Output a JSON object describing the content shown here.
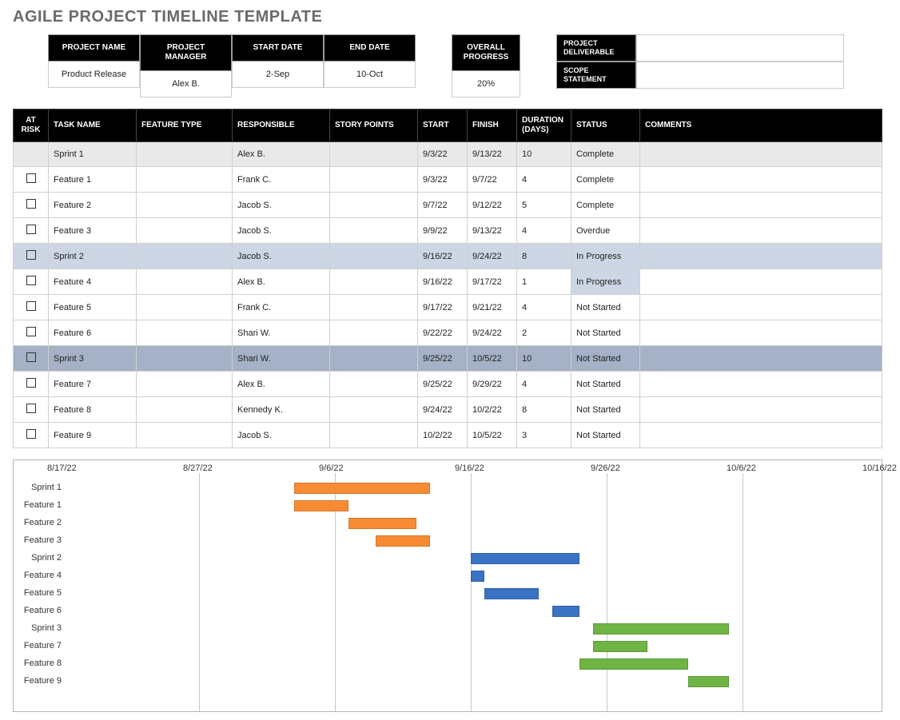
{
  "title": "AGILE PROJECT TIMELINE TEMPLATE",
  "project_headers": {
    "name": "PROJECT NAME",
    "manager": "PROJECT MANAGER",
    "start": "START DATE",
    "end": "END DATE"
  },
  "project_values": {
    "name": "Product Release",
    "manager": "Alex B.",
    "start": "2-Sep",
    "end": "10-Oct"
  },
  "overall": {
    "label": "OVERALL PROGRESS",
    "value": "20%"
  },
  "side": {
    "deliverable": "PROJECT DELIVERABLE",
    "scope": "SCOPE STATEMENT"
  },
  "task_headers": {
    "risk": "AT RISK",
    "task": "TASK NAME",
    "feature": "FEATURE TYPE",
    "resp": "RESPONSIBLE",
    "story": "STORY POINTS",
    "start": "START",
    "finish": "FINISH",
    "duration": "DURATION (DAYS)",
    "status": "STATUS",
    "comments": "COMMENTS"
  },
  "tasks": [
    {
      "row_class": "row-sprint1",
      "risk": false,
      "name": "Sprint 1",
      "feature": "",
      "resp": "Alex B.",
      "story": "",
      "start": "9/3/22",
      "finish": "9/13/22",
      "duration": "10",
      "status": "Complete",
      "comments": ""
    },
    {
      "row_class": "",
      "risk": true,
      "name": "Feature 1",
      "feature": "",
      "resp": "Frank C.",
      "story": "",
      "start": "9/3/22",
      "finish": "9/7/22",
      "duration": "4",
      "status": "Complete",
      "comments": ""
    },
    {
      "row_class": "",
      "risk": true,
      "name": "Feature 2",
      "feature": "",
      "resp": "Jacob S.",
      "story": "",
      "start": "9/7/22",
      "finish": "9/12/22",
      "duration": "5",
      "status": "Complete",
      "comments": ""
    },
    {
      "row_class": "",
      "risk": true,
      "name": "Feature 3",
      "feature": "",
      "resp": "Jacob S.",
      "story": "",
      "start": "9/9/22",
      "finish": "9/13/22",
      "duration": "4",
      "status": "Overdue",
      "comments": ""
    },
    {
      "row_class": "row-sprint2",
      "risk": true,
      "name": "Sprint 2",
      "feature": "",
      "resp": "Jacob S.",
      "story": "",
      "start": "9/16/22",
      "finish": "9/24/22",
      "duration": "8",
      "status": "In Progress",
      "comments": ""
    },
    {
      "row_class": "row-prog",
      "risk": true,
      "name": "Feature 4",
      "feature": "",
      "resp": "Alex B.",
      "story": "",
      "start": "9/16/22",
      "finish": "9/17/22",
      "duration": "1",
      "status": "In Progress",
      "comments": ""
    },
    {
      "row_class": "",
      "risk": true,
      "name": "Feature 5",
      "feature": "",
      "resp": "Frank C.",
      "story": "",
      "start": "9/17/22",
      "finish": "9/21/22",
      "duration": "4",
      "status": "Not Started",
      "comments": ""
    },
    {
      "row_class": "",
      "risk": true,
      "name": "Feature 6",
      "feature": "",
      "resp": "Shari W.",
      "story": "",
      "start": "9/22/22",
      "finish": "9/24/22",
      "duration": "2",
      "status": "Not Started",
      "comments": ""
    },
    {
      "row_class": "row-sprint3",
      "risk": true,
      "name": "Sprint 3",
      "feature": "",
      "resp": "Shari W.",
      "story": "",
      "start": "9/25/22",
      "finish": "10/5/22",
      "duration": "10",
      "status": "Not Started",
      "comments": ""
    },
    {
      "row_class": "",
      "risk": true,
      "name": "Feature 7",
      "feature": "",
      "resp": "Alex B.",
      "story": "",
      "start": "9/25/22",
      "finish": "9/29/22",
      "duration": "4",
      "status": "Not Started",
      "comments": ""
    },
    {
      "row_class": "",
      "risk": true,
      "name": "Feature 8",
      "feature": "",
      "resp": "Kennedy K.",
      "story": "",
      "start": "9/24/22",
      "finish": "10/2/22",
      "duration": "8",
      "status": "Not Started",
      "comments": ""
    },
    {
      "row_class": "",
      "risk": true,
      "name": "Feature 9",
      "feature": "",
      "resp": "Jacob S.",
      "story": "",
      "start": "10/2/22",
      "finish": "10/5/22",
      "duration": "3",
      "status": "Not Started",
      "comments": ""
    }
  ],
  "chart_data": {
    "type": "gantt",
    "x_ticks": [
      "8/17/22",
      "8/27/22",
      "9/6/22",
      "9/16/22",
      "9/26/22",
      "10/6/22",
      "10/16/22"
    ],
    "x_range_days": 60,
    "x_start": "8/17/22",
    "colors": {
      "sprint1": "#f78b33",
      "sprint2": "#3a72c4",
      "sprint3": "#6fb444"
    },
    "bars": [
      {
        "label": "Sprint 1",
        "start_day": 17,
        "dur": 10,
        "color": "c-orange"
      },
      {
        "label": "Feature 1",
        "start_day": 17,
        "dur": 4,
        "color": "c-orange"
      },
      {
        "label": "Feature 2",
        "start_day": 21,
        "dur": 5,
        "color": "c-orange"
      },
      {
        "label": "Feature 3",
        "start_day": 23,
        "dur": 4,
        "color": "c-orange"
      },
      {
        "label": "Sprint 2",
        "start_day": 30,
        "dur": 8,
        "color": "c-blue"
      },
      {
        "label": "Feature 4",
        "start_day": 30,
        "dur": 1,
        "color": "c-blue"
      },
      {
        "label": "Feature 5",
        "start_day": 31,
        "dur": 4,
        "color": "c-blue"
      },
      {
        "label": "Feature 6",
        "start_day": 36,
        "dur": 2,
        "color": "c-blue"
      },
      {
        "label": "Sprint 3",
        "start_day": 39,
        "dur": 10,
        "color": "c-green"
      },
      {
        "label": "Feature 7",
        "start_day": 39,
        "dur": 4,
        "color": "c-green"
      },
      {
        "label": "Feature 8",
        "start_day": 38,
        "dur": 8,
        "color": "c-green"
      },
      {
        "label": "Feature 9",
        "start_day": 46,
        "dur": 3,
        "color": "c-green"
      }
    ]
  }
}
